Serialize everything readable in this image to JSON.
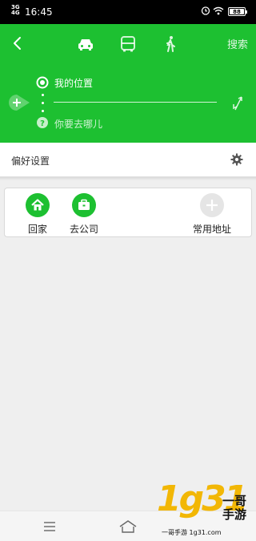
{
  "status_bar": {
    "signal": "3G",
    "signal2": "4G",
    "time": "16:45",
    "battery": "88"
  },
  "header": {
    "modes": [
      {
        "icon": "car-icon",
        "active": true
      },
      {
        "icon": "bus-icon",
        "active": false
      },
      {
        "icon": "walk-icon",
        "active": false
      }
    ],
    "search_label": "搜索",
    "origin_label": "我的位置",
    "destination_placeholder": "你要去哪儿",
    "accent_color": "#1dc031"
  },
  "preferences": {
    "label": "偏好设置"
  },
  "favorites": [
    {
      "label": "回家",
      "icon": "home-icon"
    },
    {
      "label": "去公司",
      "icon": "briefcase-icon"
    },
    {
      "label": "常用地址",
      "icon": "plus-icon"
    }
  ],
  "watermark": {
    "digits": "1g31",
    "brand": "一哥手游",
    "site": "一哥手游 1g31.com"
  }
}
